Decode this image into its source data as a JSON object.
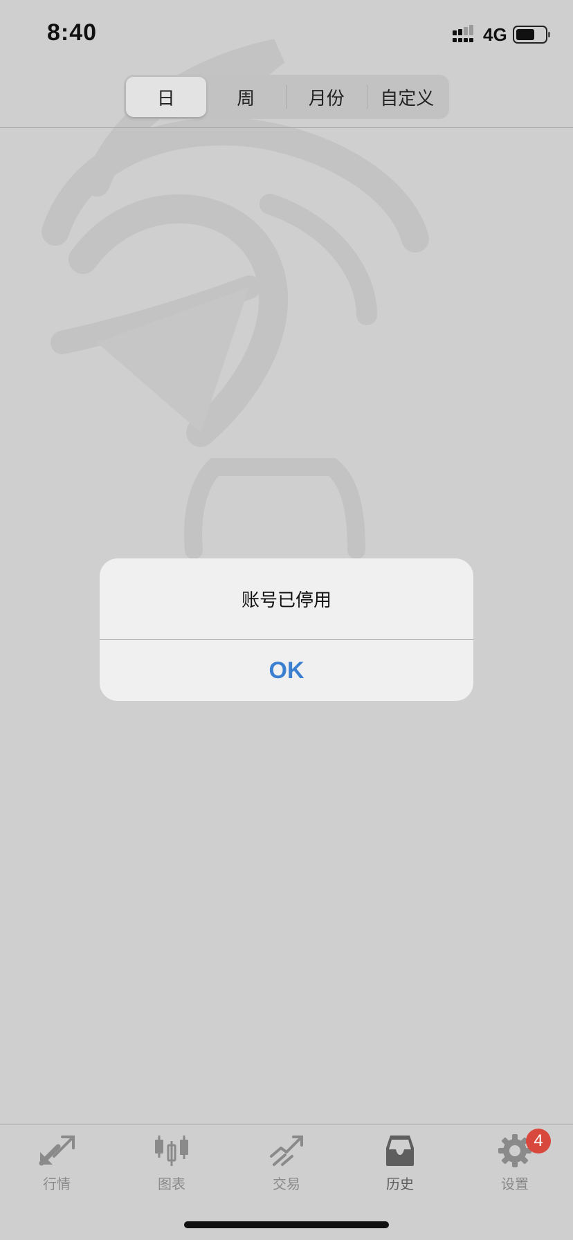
{
  "status_bar": {
    "time": "8:40",
    "network": "4G"
  },
  "segmented_control": {
    "items": [
      {
        "label": "日",
        "active": true
      },
      {
        "label": "周",
        "active": false
      },
      {
        "label": "月份",
        "active": false
      },
      {
        "label": "自定义",
        "active": false
      }
    ]
  },
  "alert": {
    "message": "账号已停用",
    "button_label": "OK"
  },
  "tab_bar": {
    "items": [
      {
        "label": "行情",
        "icon": "quotes-arrows-icon"
      },
      {
        "label": "图表",
        "icon": "candlestick-chart-icon"
      },
      {
        "label": "交易",
        "icon": "trade-trend-icon"
      },
      {
        "label": "历史",
        "icon": "history-inbox-icon"
      },
      {
        "label": "设置",
        "icon": "gear-icon"
      }
    ],
    "settings_badge": "4"
  },
  "colors": {
    "accent": "#3b7fd0",
    "badge": "#d9483c",
    "background": "#cfcfcf"
  }
}
